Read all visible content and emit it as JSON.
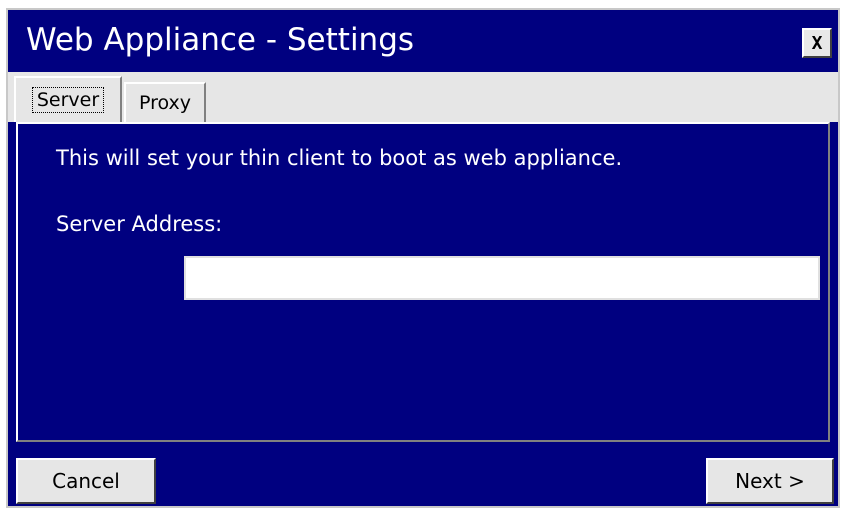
{
  "window": {
    "title": "Web Appliance - Settings",
    "close_label": "X"
  },
  "tabs": [
    {
      "label": "Server",
      "active": true
    },
    {
      "label": "Proxy",
      "active": false
    }
  ],
  "panel": {
    "description": "This will set your thin client to boot as web appliance.",
    "server_address_label": "Server Address:",
    "server_address_value": ""
  },
  "footer": {
    "cancel_label": "Cancel",
    "next_label": "Next >"
  },
  "colors": {
    "background": "#000080",
    "chrome": "#e6e6e6",
    "text": "#ffffff"
  },
  "icons": {
    "close": "close-icon"
  }
}
